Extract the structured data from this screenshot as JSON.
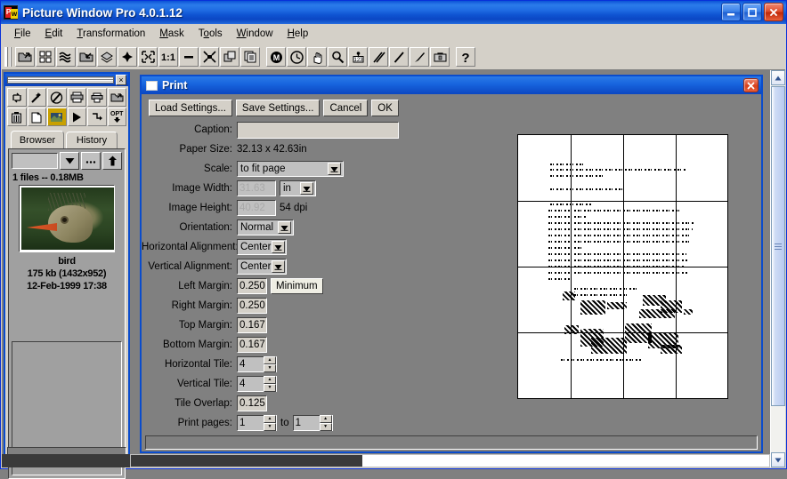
{
  "app": {
    "title": "Picture Window Pro 4.0.1.12",
    "icon": "app-logo-icon",
    "window_buttons": [
      {
        "name": "minimize-button",
        "glyph": "minimize-icon"
      },
      {
        "name": "maximize-button",
        "glyph": "maximize-icon"
      },
      {
        "name": "close-button",
        "glyph": "close-icon"
      }
    ]
  },
  "menubar": {
    "items": [
      {
        "label": "File",
        "accel": "F"
      },
      {
        "label": "Edit",
        "accel": "E"
      },
      {
        "label": "Transformation",
        "accel": "T"
      },
      {
        "label": "Mask",
        "accel": "M"
      },
      {
        "label": "Tools",
        "accel": "o"
      },
      {
        "label": "Window",
        "accel": "W"
      },
      {
        "label": "Help",
        "accel": "H"
      }
    ]
  },
  "toolbar": {
    "buttons": [
      {
        "icon": "open-folder-icon"
      },
      {
        "icon": "browser-grid-icon"
      },
      {
        "icon": "waves-icon"
      },
      {
        "icon": "open-image-icon"
      },
      {
        "icon": "stack-icon"
      },
      {
        "icon": "plus-icon"
      },
      {
        "icon": "fit-window-icon"
      },
      {
        "icon": "one-to-one-icon"
      },
      {
        "icon": "minus-icon"
      },
      {
        "icon": "shrink-icon"
      },
      {
        "icon": "copy-windows-icon"
      },
      {
        "icon": "tile-windows-icon"
      },
      {
        "icon": "mask-m-icon"
      },
      {
        "icon": "clock-icon"
      },
      {
        "icon": "hand-icon"
      },
      {
        "icon": "magnifier-icon"
      },
      {
        "icon": "pixel-info-icon"
      },
      {
        "icon": "double-line-icon"
      },
      {
        "icon": "line-icon"
      },
      {
        "icon": "brush-icon"
      },
      {
        "icon": "toolbox-icon"
      },
      {
        "icon": "help-question-icon"
      }
    ]
  },
  "browser_window": {
    "close_label": "×",
    "toolbar_buttons": [
      {
        "icon": "refresh-icon"
      },
      {
        "icon": "magic-wand-icon"
      },
      {
        "icon": "no-wand-icon"
      },
      {
        "icon": "printer-icon"
      },
      {
        "icon": "print-small-icon"
      },
      {
        "icon": "open-folder-icon"
      },
      {
        "icon": "trash-icon"
      },
      {
        "icon": "new-file-icon"
      },
      {
        "icon": "thumbnail-icon"
      },
      {
        "icon": "play-icon"
      },
      {
        "icon": "step-icon"
      },
      {
        "icon": "options-icon"
      }
    ],
    "options_label": "OPT",
    "tabs": [
      {
        "label": "Browser",
        "active": true
      },
      {
        "label": "History",
        "active": false
      }
    ],
    "path_value": "",
    "path_buttons": [
      {
        "icon": "chevron-down-icon"
      },
      {
        "icon": "ellipsis-icon"
      },
      {
        "icon": "up-arrow-icon"
      }
    ],
    "files_summary": "1 files -- 0.18MB",
    "thumbnail": {
      "name": "bird",
      "size_line": "175 kb (1432x952)",
      "date_line": "12-Feb-1999 17:38"
    }
  },
  "print_dialog": {
    "title": "Print",
    "icon": "document-icon",
    "close_label": "×",
    "buttons": [
      {
        "label": "Load Settings...",
        "name": "load-settings-button"
      },
      {
        "label": "Save Settings...",
        "name": "save-settings-button"
      },
      {
        "label": "Cancel",
        "name": "cancel-button"
      },
      {
        "label": "OK",
        "name": "ok-button"
      }
    ],
    "fields": {
      "caption": {
        "label": "Caption:",
        "value": ""
      },
      "paper_size": {
        "label": "Paper Size:",
        "value": "32.13 x 42.63in"
      },
      "scale": {
        "label": "Scale:",
        "value": "to fit page"
      },
      "image_width": {
        "label": "Image Width:",
        "value": "31.63",
        "unit": "in",
        "disabled": true
      },
      "image_height": {
        "label": "Image Height:",
        "value": "40.92",
        "dpi": "54 dpi",
        "disabled": true
      },
      "orientation": {
        "label": "Orientation:",
        "value": "Normal"
      },
      "horizontal_alignment": {
        "label": "Horizontal Alignment:",
        "value": "Center"
      },
      "vertical_alignment": {
        "label": "Vertical Alignment:",
        "value": "Center"
      },
      "left_margin": {
        "label": "Left Margin:",
        "value": "0.250",
        "button": "Minimum"
      },
      "right_margin": {
        "label": "Right Margin:",
        "value": "0.250"
      },
      "top_margin": {
        "label": "Top Margin:",
        "value": "0.167"
      },
      "bottom_margin": {
        "label": "Bottom Margin:",
        "value": "0.167"
      },
      "horizontal_tile": {
        "label": "Horizontal Tile:",
        "value": "4"
      },
      "vertical_tile": {
        "label": "Vertical Tile:",
        "value": "4"
      },
      "tile_overlap": {
        "label": "Tile Overlap:",
        "value": "0.125"
      },
      "print_pages": {
        "label": "Print pages:",
        "from": "1",
        "to_label": "to",
        "to": "1"
      }
    },
    "preview": {
      "tiles_horizontal": 4,
      "tiles_vertical": 4,
      "content_description": "scanned-document-page"
    }
  },
  "colors": {
    "titlebar_blue": "#0a52d6",
    "dialog_gray": "#808080",
    "face_gray": "#d4d0c8",
    "close_red": "#d8401c"
  }
}
